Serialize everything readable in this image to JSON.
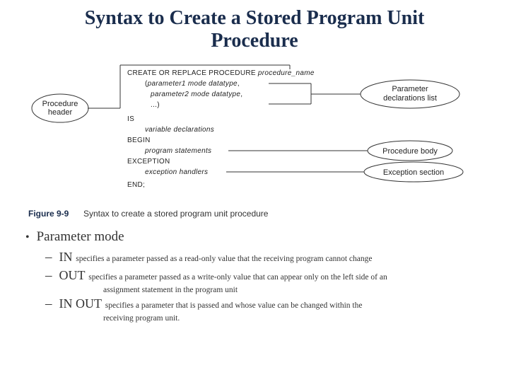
{
  "title_line1": "Syntax to Create a Stored Program Unit",
  "title_line2": "Procedure",
  "figure": {
    "labels": {
      "proc_header": "Procedure",
      "proc_header2": "header",
      "param_list1": "Parameter",
      "param_list2": "declarations list",
      "proc_body": "Procedure body",
      "exc_section": "Exception section"
    },
    "code": {
      "l1a": "CREATE OR REPLACE PROCEDURE ",
      "l1b": "procedure_name",
      "l2a": "(",
      "l2b": "parameter1 mode datatype",
      "l2c": ",",
      "l3a": "parameter2 mode datatype",
      "l3b": ",",
      "l4": "...)",
      "l5": "IS",
      "l6": "variable declarations",
      "l7": "BEGIN",
      "l8": "program statements",
      "l9": "EXCEPTION",
      "l10": "exception handlers",
      "l11": "END;"
    },
    "caption_label": "Figure 9-9",
    "caption_text": "Syntax to create a stored program unit procedure"
  },
  "bullets": {
    "b1": "Parameter mode",
    "in_kw": "IN",
    "in_desc": " specifies a parameter passed as a read-only value that the receiving program cannot change",
    "out_kw": "OUT",
    "out_desc": " specifies a parameter passed as a write-only value that can appear only on the left side of an",
    "out_desc2": "assignment statement in the program unit",
    "inout_kw": "IN OUT",
    "inout_desc": " specifies a parameter that is passed and whose value can be changed within the",
    "inout_desc2": "receiving program unit."
  }
}
